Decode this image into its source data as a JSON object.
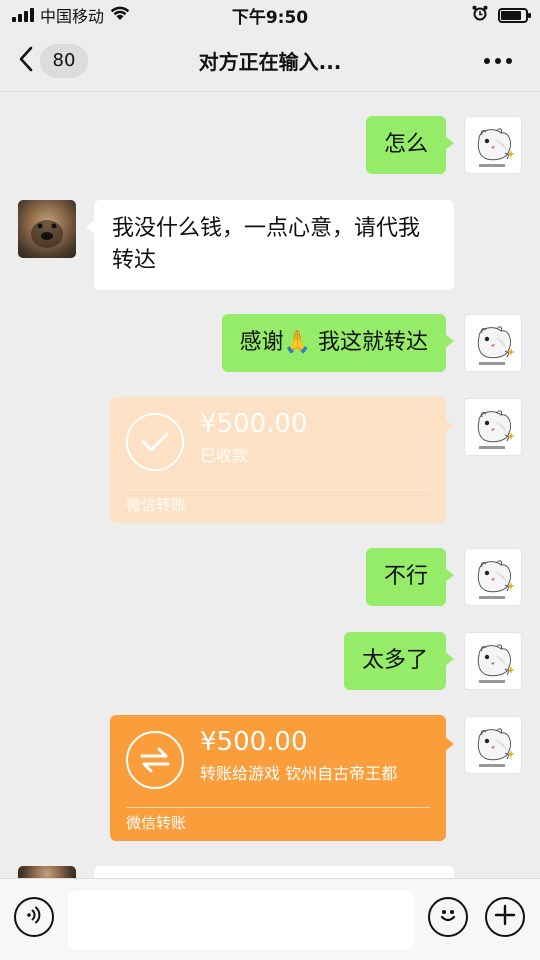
{
  "status_bar": {
    "carrier": "中国移动",
    "time": "下午9:50"
  },
  "nav": {
    "unread_count": "80",
    "title": "对方正在输入..."
  },
  "messages": [
    {
      "side": "self",
      "type": "text",
      "text": "怎么"
    },
    {
      "side": "other",
      "type": "text",
      "text": "我没什么钱，一点心意，请代我转达"
    },
    {
      "side": "self",
      "type": "text",
      "text_before": "感谢",
      "emoji": "🙏",
      "text_after": " 我这就转达"
    },
    {
      "side": "self",
      "type": "transfer",
      "state": "received",
      "amount": "¥500.00",
      "status": "已收款",
      "footer": "微信转账"
    },
    {
      "side": "self",
      "type": "text",
      "text": "不行"
    },
    {
      "side": "self",
      "type": "text",
      "text": "太多了"
    },
    {
      "side": "self",
      "type": "transfer",
      "state": "pending",
      "amount": "¥500.00",
      "note": "转账给游戏 钦州自古帝王都",
      "footer": "微信转账"
    }
  ],
  "colors": {
    "bubble_self": "#95ec69",
    "transfer_pending": "#fa9d3b",
    "transfer_received": "#fde1c4",
    "background": "#ededed"
  },
  "input": {
    "value": "",
    "placeholder": ""
  }
}
